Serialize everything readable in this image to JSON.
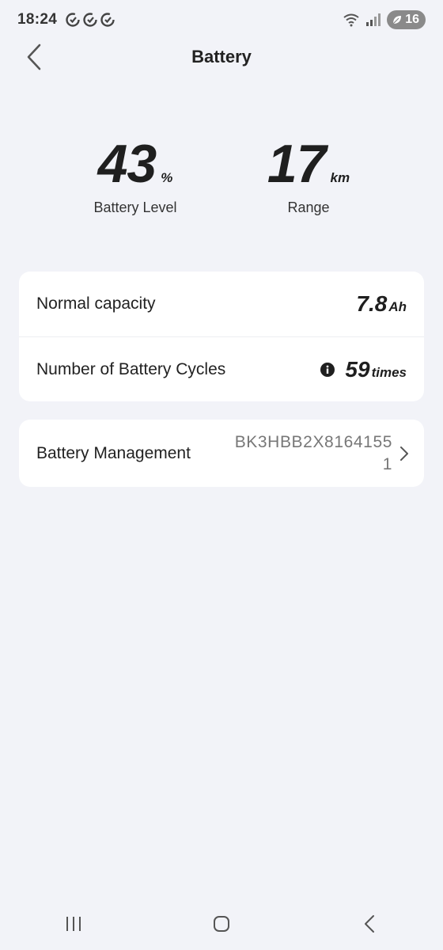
{
  "status_bar": {
    "time": "18:24",
    "battery_percent": "16",
    "icons": [
      "sync-icon",
      "sync-icon",
      "sync-icon",
      "wifi-icon",
      "signal-icon",
      "leaf-icon"
    ]
  },
  "header": {
    "title": "Battery",
    "back_icon": "chevron-left-icon"
  },
  "stats": {
    "battery_level": {
      "value": "43",
      "unit": "%",
      "label": "Battery Level"
    },
    "range": {
      "value": "17",
      "unit": "km",
      "label": "Range"
    }
  },
  "info_card": {
    "normal_capacity": {
      "label": "Normal capacity",
      "value": "7.8",
      "unit": "Ah"
    },
    "battery_cycles": {
      "label": "Number of Battery Cycles",
      "value": "59",
      "unit": "times",
      "icon": "info-icon"
    }
  },
  "management_card": {
    "label": "Battery Management",
    "serial": "BK3HBB2X81641551",
    "icon": "chevron-right-icon"
  },
  "nav_bar": {
    "icons": [
      "recent-apps-icon",
      "home-icon",
      "back-icon"
    ]
  },
  "colors": {
    "background": "#f2f3f8",
    "card": "#ffffff",
    "text_primary": "#222222",
    "text_secondary": "#777777"
  }
}
